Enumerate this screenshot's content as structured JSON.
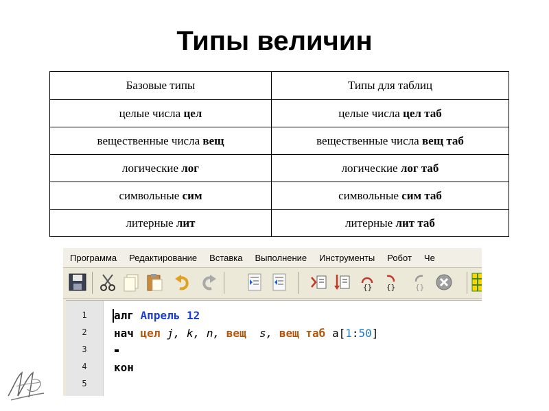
{
  "slide": {
    "title": "Типы величин"
  },
  "table": {
    "headers": [
      "Базовые типы",
      "Типы для таблиц"
    ],
    "rows": [
      {
        "base_text": "целые числа ",
        "base_kw": "цел",
        "table_text": "целые числа ",
        "table_kw": "цел таб"
      },
      {
        "base_text": "вещественные числа ",
        "base_kw": "вещ",
        "table_text": "вещественные числа ",
        "table_kw": "вещ таб"
      },
      {
        "base_text": "логические ",
        "base_kw": "лог",
        "table_text": "логические ",
        "table_kw": "лог таб"
      },
      {
        "base_text": "символьные ",
        "base_kw": "сим",
        "table_text": "символьные ",
        "table_kw": "сим таб"
      },
      {
        "base_text": "литерные ",
        "base_kw": "лит",
        "table_text": "литерные ",
        "table_kw": "лит таб"
      }
    ]
  },
  "app": {
    "menu": [
      "Программа",
      "Редактирование",
      "Вставка",
      "Выполнение",
      "Инструменты",
      "Робот",
      "Че"
    ],
    "toolbar_icons": [
      "save-icon",
      "cut-icon",
      "copy-icon",
      "paste-icon",
      "undo-icon",
      "redo-icon",
      "indent-icon",
      "unindent-icon",
      "run-icon",
      "step-icon",
      "step-into-icon",
      "step-out-icon",
      "step-back-icon",
      "stop-icon",
      "grid-icon"
    ],
    "editor": {
      "line_numbers": [
        "1",
        "2",
        "3",
        "4",
        "5"
      ],
      "line1": {
        "kw": "алг",
        "name": "Апрель 12"
      },
      "line2": {
        "kw": "нач",
        "type1": "цел",
        "vars1": "j, k, n,",
        "type2": "вещ",
        "vars2": "s,",
        "type3": "вещ таб",
        "array_name": "a[",
        "num1": "1",
        "colon": ":",
        "num2": "50",
        "close": "]"
      },
      "line4": {
        "kw": "кон"
      }
    }
  },
  "colors": {
    "keyword_type": "#b0560d",
    "algorithm_name": "#1a3ec6",
    "number": "#1a79c9"
  }
}
